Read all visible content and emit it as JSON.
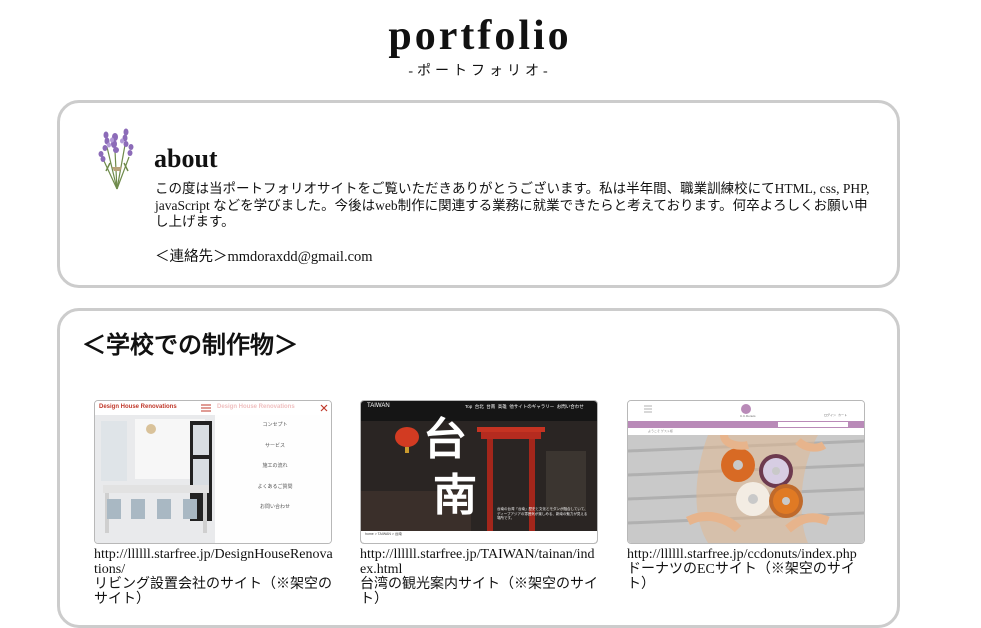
{
  "header": {
    "title": "portfolio",
    "subtitle": "-ポートフォリオ-"
  },
  "about": {
    "heading": "about",
    "body": "この度は当ポートフォリオサイトをご覧いただきありがとうございます。私は半年間、職業訓練校にてHTML, css, PHP, javaScript などを学びました。今後はweb制作に関連する業務に就業できたらと考えております。何卒よろしくお願い申し上げます。",
    "contact": "＜連絡先＞mmdoraxdd@gmail.com",
    "icon": "lavender-icon"
  },
  "works": {
    "heading": "＜学校での制作物＞",
    "items": [
      {
        "url": "http://llllll.starfree.jp/DesignHouseRenovations/",
        "desc": "リビング設置会社のサイト（※架空のサイト）",
        "thumb": {
          "logo": "Design House Renovations",
          "menu": [
            "コンセプト",
            "サービス",
            "施工の流れ",
            "よくあるご質問",
            "お問い合わせ"
          ]
        }
      },
      {
        "url": "http://llllll.starfree.jp/TAIWAN/tainan/index.html",
        "desc": "台湾の観光案内サイト（※架空のサイト）",
        "thumb": {
          "logo": "TAIWAN",
          "nav": "Top  台北  台南  高雄  他サイトのギャラリー  お問い合わせ",
          "big1": "台",
          "big2": "南",
          "caption": "台南の台湾「台南」歴史と文化とモダンが融合していて、ディープアジアの雰囲気が楽しめる、新南の魅力が見える場所です。",
          "breadcrumb": "home > TAIWAN > 台南"
        }
      },
      {
        "url": "http://llllll.starfree.jp/ccdonuts/index.php",
        "desc": "ドーナツのECサイト（※架空のサイト）",
        "thumb": {
          "logo": "C.C.Donuts",
          "links": [
            "ログイン",
            "カート"
          ],
          "breadcrumb": "ようこそ ゲスト様"
        }
      }
    ]
  },
  "colors": {
    "card_border": "#cccccc",
    "lavender": "#8c6bb8",
    "accent_red": "#c0392b",
    "donut_bar": "#b98ab8"
  }
}
